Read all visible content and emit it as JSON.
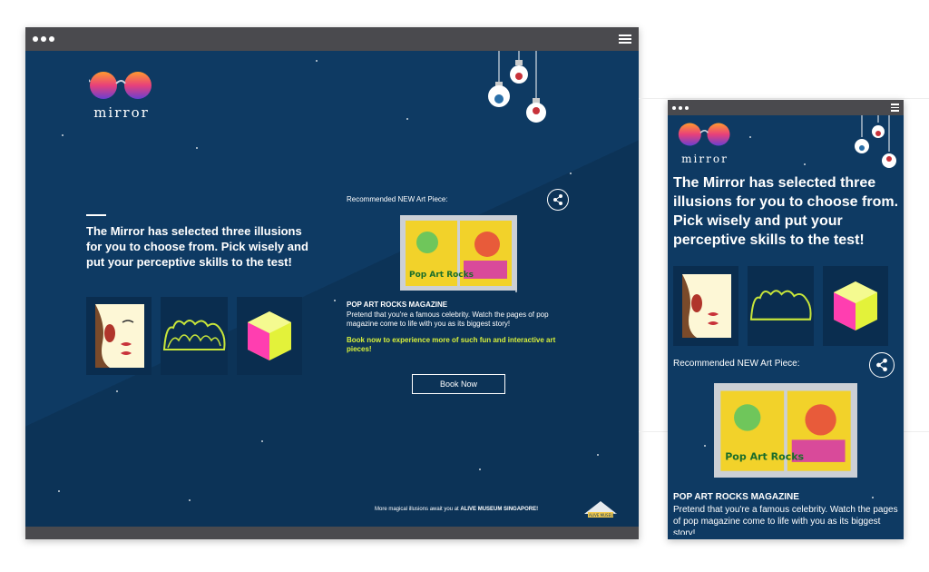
{
  "brand": {
    "name": "mirror"
  },
  "intro": {
    "headline": "The Mirror has selected three illusions for you to choose from. Pick wisely and put your perceptive skills to the test!"
  },
  "illusions": [
    {
      "icon": "face-tree-illusion-icon"
    },
    {
      "icon": "bush-illusion-icon"
    },
    {
      "icon": "cube-illusion-icon"
    }
  ],
  "recommended": {
    "label": "Recommended NEW Art Piece:",
    "title": "POP ART ROCKS MAGAZINE",
    "description": "Pretend that you're a famous celebrity. Watch the pages of pop magazine come to life with you as its biggest story!",
    "cta_text": "Book now to experience more of such fun and interactive art pieces!",
    "button_label": "Book Now",
    "magazine_text": "Pop Art Rocks"
  },
  "footer": {
    "prefix": "More magical illusions await you at",
    "venue": "ALIVE MUSEUM SINGAPORE!",
    "logo_text": "ALIVE MUSEUM"
  },
  "colors": {
    "background": "#0e3a63",
    "accent": "#d7f03b",
    "bar": "#4a4a4e"
  }
}
